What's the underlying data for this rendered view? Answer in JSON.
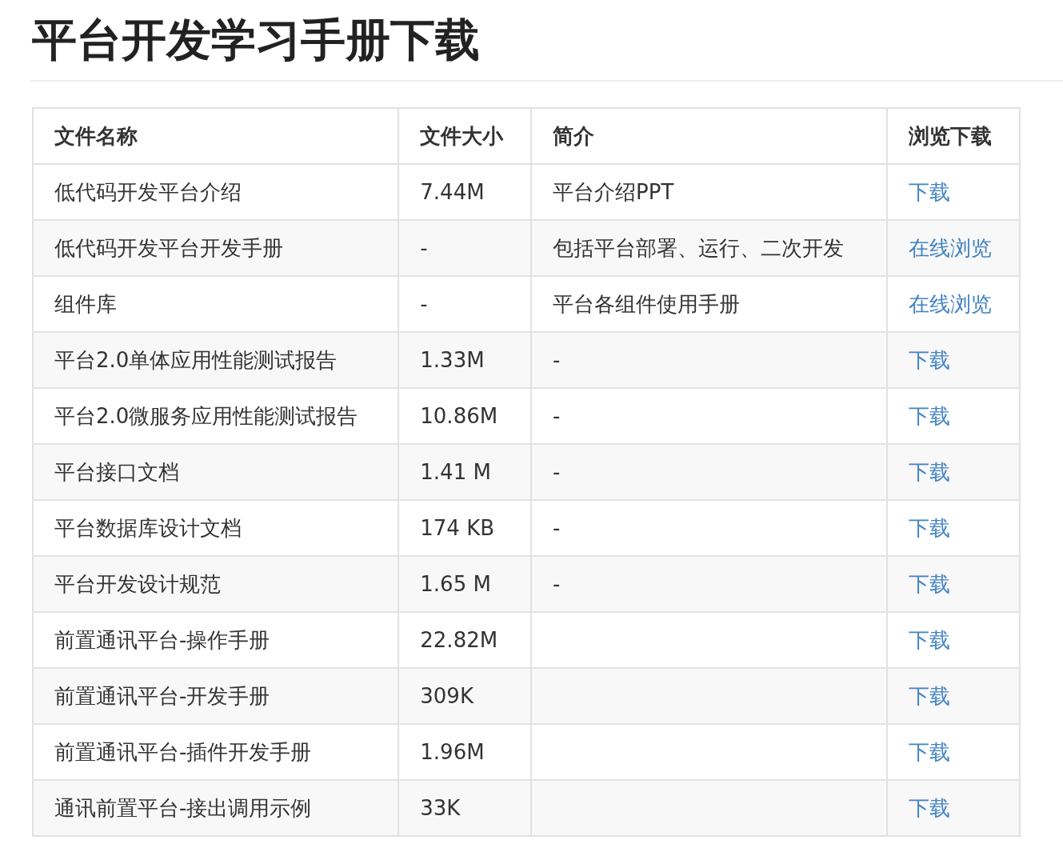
{
  "title": "平台开发学习手册下载",
  "table": {
    "columns": [
      "文件名称",
      "文件大小",
      "简介",
      "浏览下载"
    ],
    "rows": [
      {
        "name": "低代码开发平台介绍",
        "size": "7.44M",
        "description": "平台介绍PPT",
        "link": "下载"
      },
      {
        "name": "低代码开发平台开发手册",
        "size": "-",
        "description": "包括平台部署、运行、二次开发",
        "link": "在线浏览"
      },
      {
        "name": "组件库",
        "size": "-",
        "description": "平台各组件使用手册",
        "link": "在线浏览"
      },
      {
        "name": "平台2.0单体应用性能测试报告",
        "size": "1.33M",
        "description": "-",
        "link": "下载"
      },
      {
        "name": "平台2.0微服务应用性能测试报告",
        "size": "10.86M",
        "description": "-",
        "link": "下载"
      },
      {
        "name": "平台接口文档",
        "size": "1.41 M",
        "description": "-",
        "link": "下载"
      },
      {
        "name": "平台数据库设计文档",
        "size": "174 KB",
        "description": "-",
        "link": "下载"
      },
      {
        "name": "平台开发设计规范",
        "size": "1.65 M",
        "description": "-",
        "link": "下载"
      },
      {
        "name": "前置通讯平台-操作手册",
        "size": "22.82M",
        "link": "下载"
      },
      {
        "name": "前置通讯平台-开发手册",
        "size": "309K",
        "link": "下载"
      },
      {
        "name": "前置通讯平台-插件开发手册",
        "size": "1.96M",
        "link": "下载"
      },
      {
        "name": "通讯前置平台-接出调用示例",
        "size": "33K",
        "link": "下载"
      }
    ]
  }
}
